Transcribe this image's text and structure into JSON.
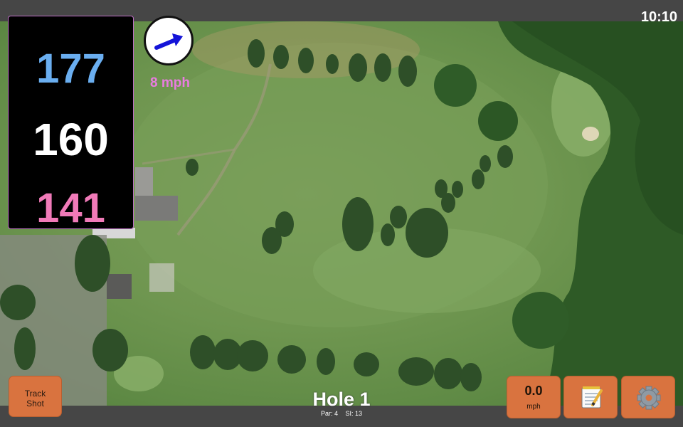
{
  "status_bar": {
    "time": "10:10"
  },
  "distances": {
    "back": "177",
    "middle": "160",
    "front": "141"
  },
  "wind": {
    "speed": "8 mph",
    "direction_icon": "arrow-right-up-icon"
  },
  "buttons": {
    "track_shot_line1": "Track",
    "track_shot_line2": "Shot",
    "speed_value": "0.0",
    "speed_unit": "mph",
    "notes_icon": "notepad-icon",
    "settings_icon": "gear-icon"
  },
  "hole": {
    "title": "Hole 1",
    "par": "Par: 4",
    "si": "SI: 13"
  },
  "colors": {
    "back_distance": "#6aaef0",
    "middle_distance": "#ffffff",
    "front_distance": "#f07ab8",
    "wind_text": "#e97ce0",
    "button": "#d9733f"
  }
}
